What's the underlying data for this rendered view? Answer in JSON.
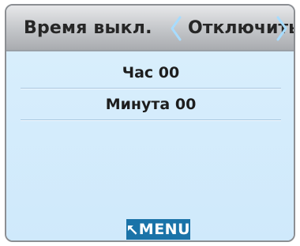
{
  "header": {
    "title": "Время выкл.",
    "value": "Отключить",
    "left_arrow_icon": "chevron-left-icon",
    "right_arrow_icon": "chevron-right-icon"
  },
  "rows": [
    {
      "label": "Час 00"
    },
    {
      "label": "Минута 00"
    }
  ],
  "menu": {
    "label": "MENU",
    "icon": "return-arrow-icon"
  },
  "colors": {
    "accent": "#1a73a8",
    "background": "#d9eefc",
    "arrow": "#a7dcff"
  }
}
